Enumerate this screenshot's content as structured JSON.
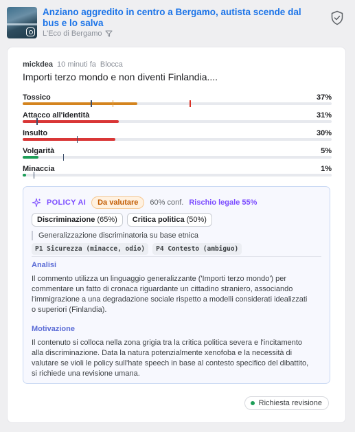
{
  "article": {
    "title": "Anziano aggredito in centro a Bergamo, autista scende dal bus e lo salva",
    "source": "L'Eco di Bergamo"
  },
  "comment": {
    "author": "mickdea",
    "time": "10 minuti fa",
    "block_label": "Blocca",
    "text": "Importi terzo mondo e non diventi Finlandia...."
  },
  "categories": [
    {
      "label": "Tossico",
      "percent_label": "37%",
      "value": 0.37,
      "color": "#d4841e",
      "markers": [
        {
          "at": 0.22,
          "color": "#3d4f6a"
        },
        {
          "at": 0.29,
          "color": "#e39b3a"
        },
        {
          "at": 0.54,
          "color": "#d93025"
        }
      ]
    },
    {
      "label": "Attacco all'identità",
      "percent_label": "31%",
      "value": 0.31,
      "color": "#d93636",
      "markers": [
        {
          "at": 0.045,
          "color": "#3d4f6a"
        }
      ]
    },
    {
      "label": "Insulto",
      "percent_label": "30%",
      "value": 0.3,
      "color": "#d93636",
      "markers": [
        {
          "at": 0.175,
          "color": "#3d4f6a"
        }
      ]
    },
    {
      "label": "Volgarità",
      "percent_label": "5%",
      "value": 0.05,
      "color": "#1e9e58",
      "markers": [
        {
          "at": 0.13,
          "color": "#3d4f6a"
        }
      ]
    },
    {
      "label": "Minaccia",
      "percent_label": "1%",
      "value": 0.012,
      "color": "#1e9e58",
      "markers": [
        {
          "at": 0.035,
          "color": "#3d4f6a"
        }
      ]
    }
  ],
  "policy": {
    "title": "POLICY AI",
    "verdict": "Da valutare",
    "confidence": "60% conf.",
    "legal_risk": "Rischio legale 55%",
    "chips": [
      {
        "name": "Discriminazione",
        "score": "(65%)"
      },
      {
        "name": "Critica politica",
        "score": "(50%)"
      }
    ],
    "description": "Generalizzazione discriminatoria su base etnica",
    "codes": [
      "P1 Sicurezza (minacce, odio)",
      "P4 Contesto (ambiguo)"
    ],
    "analysis_title": "Analisi",
    "analysis_lines": [
      "Il commento utilizza un linguaggio generalizzante ('Importi terzo mondo') per",
      "commentare un fatto di cronaca riguardante un cittadino straniero, associando",
      "l'immigrazione a una degradazione sociale rispetto a modelli considerati idealizzati",
      "o superiori (Finlandia)."
    ],
    "motivation_title": "Motivazione",
    "motivation_lines": [
      "Il contenuto si colloca nella zona grigia tra la critica politica severa e l'incitamento",
      "alla discriminazione. Data la natura potenzialmente xenofoba e la necessità di",
      "valutare se violi le policy sull'hate speech in base al contesto specifico del dibattito,",
      "si richiede una revisione umana."
    ]
  },
  "status": {
    "label": "Richiesta revisione",
    "color": "#1e9e58"
  },
  "colors": {
    "link": "#1a73e8",
    "accent": "#7c4dff",
    "section": "#5b6cd6"
  }
}
